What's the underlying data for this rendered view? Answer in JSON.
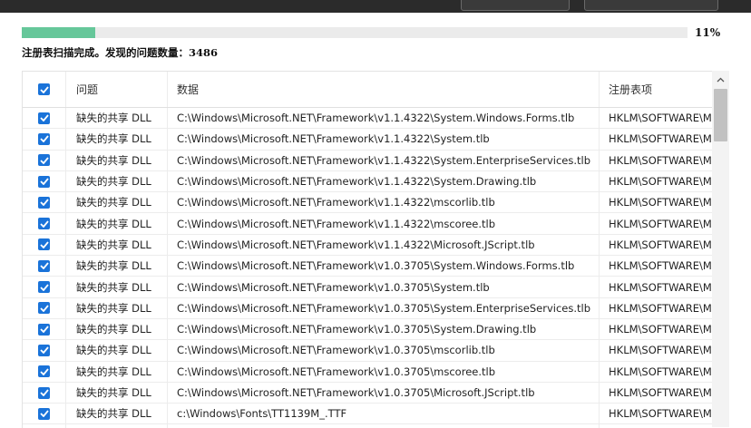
{
  "progress": {
    "percent_label": "11%",
    "fraction": 0.11
  },
  "status_text": "注册表扫描完成。发现的问题数量：3486",
  "table": {
    "headers": {
      "problem": "问题",
      "data": "数据",
      "registry": "注册表项"
    },
    "rows": [
      {
        "problem": "缺失的共享 DLL",
        "data": "C:\\Windows\\Microsoft.NET\\Framework\\v1.1.4322\\System.Windows.Forms.tlb",
        "registry": "HKLM\\SOFTWARE\\Micr",
        "checked": true
      },
      {
        "problem": "缺失的共享 DLL",
        "data": "C:\\Windows\\Microsoft.NET\\Framework\\v1.1.4322\\System.tlb",
        "registry": "HKLM\\SOFTWARE\\Micr",
        "checked": true
      },
      {
        "problem": "缺失的共享 DLL",
        "data": "C:\\Windows\\Microsoft.NET\\Framework\\v1.1.4322\\System.EnterpriseServices.tlb",
        "registry": "HKLM\\SOFTWARE\\Micr",
        "checked": true
      },
      {
        "problem": "缺失的共享 DLL",
        "data": "C:\\Windows\\Microsoft.NET\\Framework\\v1.1.4322\\System.Drawing.tlb",
        "registry": "HKLM\\SOFTWARE\\Micr",
        "checked": true
      },
      {
        "problem": "缺失的共享 DLL",
        "data": "C:\\Windows\\Microsoft.NET\\Framework\\v1.1.4322\\mscorlib.tlb",
        "registry": "HKLM\\SOFTWARE\\Micr",
        "checked": true
      },
      {
        "problem": "缺失的共享 DLL",
        "data": "C:\\Windows\\Microsoft.NET\\Framework\\v1.1.4322\\mscoree.tlb",
        "registry": "HKLM\\SOFTWARE\\Micr",
        "checked": true
      },
      {
        "problem": "缺失的共享 DLL",
        "data": "C:\\Windows\\Microsoft.NET\\Framework\\v1.1.4322\\Microsoft.JScript.tlb",
        "registry": "HKLM\\SOFTWARE\\Micr",
        "checked": true
      },
      {
        "problem": "缺失的共享 DLL",
        "data": "C:\\Windows\\Microsoft.NET\\Framework\\v1.0.3705\\System.Windows.Forms.tlb",
        "registry": "HKLM\\SOFTWARE\\Micr",
        "checked": true
      },
      {
        "problem": "缺失的共享 DLL",
        "data": "C:\\Windows\\Microsoft.NET\\Framework\\v1.0.3705\\System.tlb",
        "registry": "HKLM\\SOFTWARE\\Micr",
        "checked": true
      },
      {
        "problem": "缺失的共享 DLL",
        "data": "C:\\Windows\\Microsoft.NET\\Framework\\v1.0.3705\\System.EnterpriseServices.tlb",
        "registry": "HKLM\\SOFTWARE\\Micr",
        "checked": true
      },
      {
        "problem": "缺失的共享 DLL",
        "data": "C:\\Windows\\Microsoft.NET\\Framework\\v1.0.3705\\System.Drawing.tlb",
        "registry": "HKLM\\SOFTWARE\\Micr",
        "checked": true
      },
      {
        "problem": "缺失的共享 DLL",
        "data": "C:\\Windows\\Microsoft.NET\\Framework\\v1.0.3705\\mscorlib.tlb",
        "registry": "HKLM\\SOFTWARE\\Micr",
        "checked": true
      },
      {
        "problem": "缺失的共享 DLL",
        "data": "C:\\Windows\\Microsoft.NET\\Framework\\v1.0.3705\\mscoree.tlb",
        "registry": "HKLM\\SOFTWARE\\Micr",
        "checked": true
      },
      {
        "problem": "缺失的共享 DLL",
        "data": "C:\\Windows\\Microsoft.NET\\Framework\\v1.0.3705\\Microsoft.JScript.tlb",
        "registry": "HKLM\\SOFTWARE\\Micr",
        "checked": true
      },
      {
        "problem": "缺失的共享 DLL",
        "data": "c:\\Windows\\Fonts\\TT1139M_.TTF",
        "registry": "HKLM\\SOFTWARE\\Micr",
        "checked": true
      },
      {
        "problem": "",
        "data": "",
        "registry": "",
        "checked": true
      }
    ]
  },
  "colors": {
    "accent": "#1a73d9",
    "progress": "#66c79a"
  }
}
